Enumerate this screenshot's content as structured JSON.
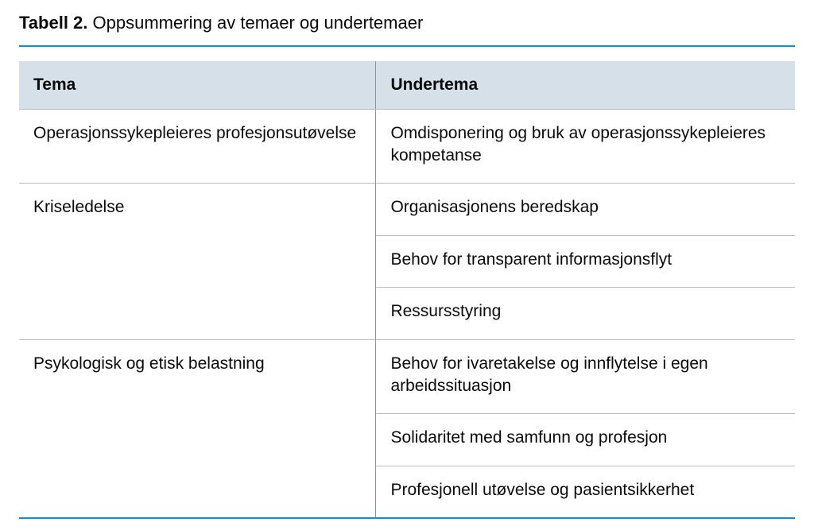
{
  "table": {
    "label": "Tabell 2.",
    "caption": "Oppsummering av temaer og undertemaer",
    "headers": {
      "theme": "Tema",
      "subtheme": "Undertema"
    },
    "rows": [
      {
        "theme": "Operasjonssykepleieres profesjonsutøvelse",
        "subthemes": [
          "Omdisponering og bruk av operasjonssykepleieres kompetanse"
        ]
      },
      {
        "theme": "Kriseledelse",
        "subthemes": [
          "Organisasjonens beredskap",
          "Behov for transparent informasjonsflyt",
          "Ressursstyring"
        ]
      },
      {
        "theme": "Psykologisk og etisk belastning",
        "subthemes": [
          "Behov for ivaretakelse og innflytelse i egen arbeidssituasjon",
          "Solidaritet med samfunn og profesjon",
          "Profesjonell utøvelse og pasientsikkerhet"
        ]
      }
    ]
  },
  "chart_data": {
    "type": "table",
    "title": "Tabell 2. Oppsummering av temaer og undertemaer",
    "columns": [
      "Tema",
      "Undertema"
    ],
    "data": [
      [
        "Operasjonssykepleieres profesjonsutøvelse",
        "Omdisponering og bruk av operasjonssykepleieres kompetanse"
      ],
      [
        "Kriseledelse",
        "Organisasjonens beredskap"
      ],
      [
        "Kriseledelse",
        "Behov for transparent informasjonsflyt"
      ],
      [
        "Kriseledelse",
        "Ressursstyring"
      ],
      [
        "Psykologisk og etisk belastning",
        "Behov for ivaretakelse og innflytelse i egen arbeidssituasjon"
      ],
      [
        "Psykologisk og etisk belastning",
        "Solidaritet med samfunn og profesjon"
      ],
      [
        "Psykologisk og etisk belastning",
        "Profesjonell utøvelse og pasientsikkerhet"
      ]
    ]
  }
}
